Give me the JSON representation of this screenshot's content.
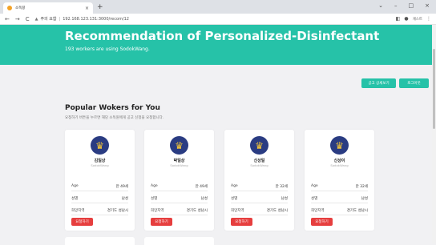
{
  "browser": {
    "tab_title": "소독왕",
    "tab_close": "×",
    "new_tab": "+",
    "window_controls": [
      "⌄",
      "–",
      "□",
      "×"
    ],
    "nav": {
      "back": "←",
      "forward": "→",
      "reload": "C"
    },
    "security_label": "주의 요함",
    "url": "192.168.123.131:3000/recom/12",
    "profile": "게스트"
  },
  "hero": {
    "title": "Recommendation of Personalized-Disinfectant",
    "subtitle": "193 workers are using SodokWang.",
    "color": "#26c2a8"
  },
  "actions": {
    "detail_label": "공고 상세보기",
    "logout_label": "로그아웃"
  },
  "section": {
    "title": "Popular Wokers for You",
    "description": "요청하기 버튼을 누르면 해당 소독원에게 공고 신청을 요청합니다."
  },
  "labels": {
    "age": "Age",
    "gender": "성별",
    "area": "희망지역",
    "request_button": "요청하기",
    "brand": "SodokWang"
  },
  "workers": [
    {
      "name": "김일상",
      "age": "만 49세",
      "gender": "남성",
      "area": "경기도 성남시"
    },
    {
      "name": "박일상",
      "age": "만 49세",
      "gender": "남성",
      "area": "경기도 성남시"
    },
    {
      "name": "신상일",
      "age": "만 32세",
      "gender": "남성",
      "area": "경기도 성남시"
    },
    {
      "name": "신상이",
      "age": "만 32세",
      "gender": "남성",
      "area": "경기도 성남시"
    }
  ]
}
